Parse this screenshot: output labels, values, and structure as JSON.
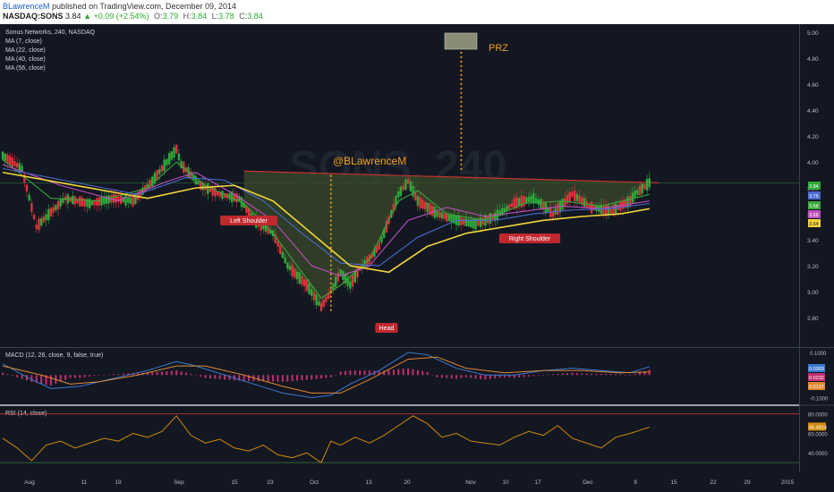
{
  "header": {
    "author": "BLawrenceM",
    "published_text": "published on TradingView.com, December 09, 2014",
    "symbol": "NASDAQ:SONS",
    "last": "3.84",
    "change": "▲ +0.09 (+2.54%)",
    "open_label": "O:",
    "open": "3.79",
    "high_label": "H:",
    "high": "3.84",
    "low_label": "L:",
    "low": "3.78",
    "close_label": "C:",
    "close": "3.84"
  },
  "main_pane": {
    "legend": [
      "Sonus Networks, 240, NASDAQ",
      "MA (7, close)",
      "MA (22, close)",
      "MA (40, close)",
      "MA (56, close)"
    ],
    "watermark": "SONS, 240"
  },
  "annotations": {
    "handle": "@BLawrenceM",
    "prz": "PRZ",
    "left_shoulder": "Left Shoulder",
    "head": "Head",
    "right_shoulder": "Right Shoulder"
  },
  "macd_pane": {
    "legend": "MACD (12, 26, close, 9, false, true)"
  },
  "rsi_pane": {
    "legend": "RSI (14, close)"
  },
  "colors": {
    "background": "#131722",
    "up_candle": "#2eaa3a",
    "down_candle": "#e0323a",
    "ma7": "#3aa83a",
    "ma22": "#c050c0",
    "ma40": "#4a6ad0",
    "ma56": "#f2d43a",
    "pattern_fill": "#3a4a2a",
    "neckline": "#c83030",
    "rsi": "#d08a10",
    "macd": "#3a7ad0",
    "signal": "#e08830",
    "histogram": "#c03070"
  },
  "chart_data": [
    {
      "type": "candlestick",
      "title": "Sonus Networks, 240, NASDAQ",
      "ylim": [
        2.6,
        5.05
      ],
      "y_ticks": [
        "5.00",
        "4.80",
        "4.60",
        "4.40",
        "4.20",
        "4.00",
        "3.80",
        "3.60",
        "3.40",
        "3.20",
        "3.00",
        "2.80"
      ],
      "x_tick_labels": [
        "Aug",
        "11",
        "19",
        "Sep",
        "15",
        "23",
        "Oct",
        "13",
        "20",
        "Nov",
        "10",
        "17",
        "Dec",
        "9",
        "15",
        "22",
        "29",
        "2015"
      ],
      "price_labels": [
        {
          "value": "3.84",
          "color": "#2eaa3a"
        },
        {
          "value": "3.75",
          "color": "#4a6ad0"
        },
        {
          "value": "3.68",
          "color": "#3aa83a"
        },
        {
          "value": "3.66",
          "color": "#c050c0"
        },
        {
          "value": "3.64",
          "color": "#f2d43a"
        }
      ],
      "series": [
        {
          "name": "Price",
          "x_day": [
            0,
            4,
            7,
            11,
            13,
            18,
            23,
            27,
            31,
            36,
            37,
            41,
            45,
            49,
            52,
            56,
            59,
            63,
            66,
            68,
            70,
            72,
            74,
            76,
            78,
            80,
            82,
            84,
            86,
            90,
            94,
            98,
            102,
            106,
            110,
            114,
            118,
            122,
            126,
            130,
            131,
            134
          ],
          "y": [
            4.05,
            3.95,
            3.5,
            3.65,
            3.72,
            3.68,
            3.72,
            3.7,
            3.85,
            4.1,
            3.98,
            3.82,
            3.75,
            3.72,
            3.55,
            3.45,
            3.2,
            3.05,
            2.88,
            3.0,
            3.15,
            3.05,
            3.18,
            3.25,
            3.35,
            3.55,
            3.75,
            3.85,
            3.7,
            3.6,
            3.55,
            3.52,
            3.58,
            3.68,
            3.72,
            3.6,
            3.75,
            3.65,
            3.62,
            3.7,
            3.75,
            3.84
          ]
        },
        {
          "name": "MA (7, close)",
          "x_day": [
            0,
            10,
            20,
            30,
            36,
            42,
            50,
            56,
            62,
            66,
            70,
            76,
            82,
            86,
            92,
            100,
            108,
            116,
            124,
            134
          ],
          "y": [
            4.02,
            3.72,
            3.7,
            3.8,
            4.0,
            3.82,
            3.68,
            3.45,
            3.15,
            2.95,
            3.05,
            3.25,
            3.7,
            3.78,
            3.6,
            3.55,
            3.68,
            3.7,
            3.66,
            3.75
          ]
        },
        {
          "name": "MA (22, close)",
          "x_day": [
            0,
            12,
            24,
            34,
            40,
            48,
            56,
            64,
            70,
            76,
            84,
            92,
            100,
            108,
            116,
            124,
            134
          ],
          "y": [
            3.98,
            3.82,
            3.7,
            3.85,
            3.92,
            3.75,
            3.55,
            3.2,
            3.12,
            3.2,
            3.55,
            3.65,
            3.58,
            3.62,
            3.66,
            3.64,
            3.7
          ]
        },
        {
          "name": "MA (40, close)",
          "x_day": [
            0,
            14,
            28,
            38,
            46,
            54,
            62,
            70,
            78,
            86,
            94,
            102,
            110,
            118,
            126,
            134
          ],
          "y": [
            3.95,
            3.85,
            3.75,
            3.88,
            3.86,
            3.7,
            3.45,
            3.22,
            3.2,
            3.42,
            3.55,
            3.55,
            3.6,
            3.63,
            3.64,
            3.68
          ]
        },
        {
          "name": "MA (56, close)",
          "x_day": [
            0,
            15,
            30,
            40,
            48,
            56,
            64,
            72,
            80,
            88,
            96,
            104,
            112,
            120,
            128,
            134
          ],
          "y": [
            3.92,
            3.82,
            3.72,
            3.8,
            3.82,
            3.7,
            3.45,
            3.2,
            3.15,
            3.35,
            3.45,
            3.5,
            3.55,
            3.58,
            3.6,
            3.64
          ]
        }
      ],
      "neckline": {
        "x_day": [
          50,
          136
        ],
        "y": [
          3.93,
          3.84
        ]
      },
      "head_target_line": {
        "x_day": 68,
        "y": [
          2.84,
          3.9
        ]
      },
      "prz_line": {
        "x_day": 95,
        "y": [
          3.94,
          4.92
        ]
      }
    },
    {
      "type": "line",
      "title": "MACD (12, 26, close, 9, false, true)",
      "ylim": [
        -0.13,
        0.12
      ],
      "y_ticks": [
        "0.1000",
        "-0.1000"
      ],
      "value_labels": [
        {
          "value": "0.0369",
          "color": "#3a7ad0"
        },
        {
          "value": "0.0232",
          "color": "#c03070"
        },
        {
          "value": "0.0137",
          "color": "#e08830"
        }
      ],
      "series": [
        {
          "name": "MACD",
          "x_day": [
            0,
            6,
            10,
            16,
            22,
            30,
            36,
            40,
            46,
            52,
            58,
            64,
            68,
            72,
            78,
            84,
            88,
            94,
            100,
            106,
            112,
            118,
            124,
            130,
            134
          ],
          "y": [
            0.05,
            -0.02,
            -0.06,
            -0.05,
            -0.02,
            0.02,
            0.06,
            0.04,
            0.0,
            -0.04,
            -0.08,
            -0.1,
            -0.09,
            -0.04,
            0.02,
            0.1,
            0.09,
            0.03,
            0.0,
            0.0,
            0.02,
            0.03,
            0.02,
            0.01,
            0.037
          ]
        },
        {
          "name": "Signal",
          "x_day": [
            0,
            8,
            14,
            20,
            28,
            36,
            42,
            50,
            58,
            64,
            70,
            76,
            84,
            90,
            96,
            104,
            112,
            120,
            128,
            134
          ],
          "y": [
            0.04,
            0.0,
            -0.04,
            -0.03,
            0.0,
            0.04,
            0.04,
            0.0,
            -0.05,
            -0.08,
            -0.08,
            -0.02,
            0.07,
            0.08,
            0.03,
            0.01,
            0.02,
            0.02,
            0.01,
            0.0137
          ]
        }
      ]
    },
    {
      "type": "line",
      "title": "RSI (14, close)",
      "ylim": [
        20,
        88
      ],
      "y_ticks": [
        "80.0000",
        "60.0000",
        "40.0000"
      ],
      "value_labels": [
        {
          "value": "66.4814",
          "color": "#d08a10"
        }
      ],
      "series": [
        {
          "name": "RSI",
          "x_day": [
            0,
            3,
            6,
            9,
            12,
            15,
            18,
            21,
            24,
            27,
            30,
            33,
            36,
            39,
            42,
            45,
            48,
            51,
            54,
            57,
            60,
            63,
            66,
            68,
            70,
            73,
            76,
            79,
            82,
            85,
            88,
            91,
            94,
            97,
            100,
            103,
            106,
            109,
            112,
            115,
            118,
            121,
            124,
            127,
            130,
            134
          ],
          "y": [
            55,
            45,
            32,
            48,
            52,
            45,
            50,
            55,
            52,
            60,
            56,
            62,
            78,
            58,
            50,
            54,
            45,
            42,
            48,
            38,
            35,
            40,
            30,
            52,
            48,
            56,
            50,
            58,
            68,
            78,
            70,
            56,
            60,
            52,
            50,
            48,
            56,
            62,
            58,
            68,
            55,
            50,
            45,
            56,
            60,
            66.48
          ]
        }
      ]
    }
  ]
}
